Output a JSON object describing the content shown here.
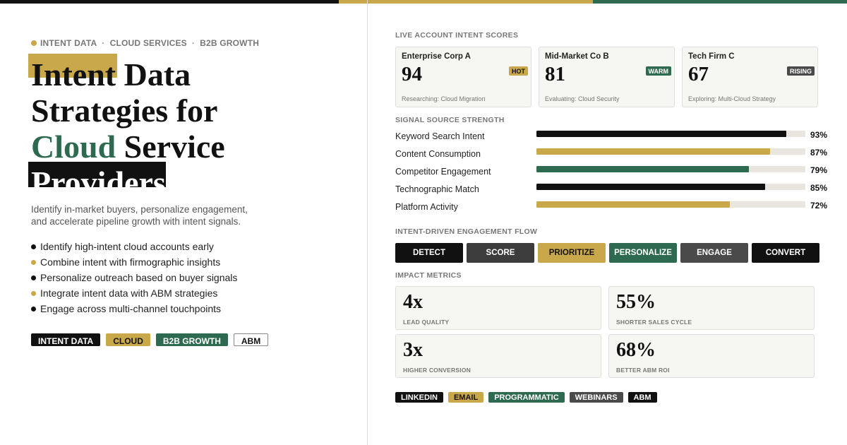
{
  "breadcrumb": [
    "INTENT DATA",
    "CLOUD SERVICES",
    "B2B GROWTH"
  ],
  "title": {
    "line1_highlight": "Intent",
    "line1_rest": " Data",
    "line2": "Strategies for",
    "line3_green": "Cloud",
    "line3_rest": " Service",
    "line4_inverted": "Providers"
  },
  "subtitle": "Identify in-market buyers, personalize engagement, and accelerate pipeline growth with intent signals.",
  "bullets": [
    {
      "text": "Identify high-intent cloud accounts early",
      "color": "#111111"
    },
    {
      "text": "Combine intent with firmographic insights",
      "color": "#c9a84c"
    },
    {
      "text": "Personalize outreach based on buyer signals",
      "color": "#111111"
    },
    {
      "text": "Integrate intent data with ABM strategies",
      "color": "#c9a84c"
    },
    {
      "text": "Engage across multi-channel touchpoints",
      "color": "#111111"
    }
  ],
  "left_tags": [
    "INTENT DATA",
    "CLOUD",
    "B2B GROWTH",
    "ABM"
  ],
  "section_labels": {
    "scores": "LIVE ACCOUNT INTENT SCORES",
    "signals": "SIGNAL SOURCE STRENGTH",
    "flow": "INTENT-DRIVEN ENGAGEMENT FLOW",
    "impact": "IMPACT METRICS"
  },
  "accounts": [
    {
      "name": "Enterprise Corp A",
      "score": "94",
      "badge": "HOT",
      "note": "Researching: Cloud Migration"
    },
    {
      "name": "Mid-Market Co B",
      "score": "81",
      "badge": "WARM",
      "note": "Evaluating: Cloud Security"
    },
    {
      "name": "Tech Firm C",
      "score": "67",
      "badge": "RISING",
      "note": "Exploring: Multi-Cloud Strategy"
    }
  ],
  "signals": [
    {
      "label": "Keyword Search Intent",
      "value": 93,
      "display": "93%",
      "color": "#111111"
    },
    {
      "label": "Content Consumption",
      "value": 87,
      "display": "87%",
      "color": "#c9a84c"
    },
    {
      "label": "Competitor Engagement",
      "value": 79,
      "display": "79%",
      "color": "#2d6a4f"
    },
    {
      "label": "Technographic Match",
      "value": 85,
      "display": "85%",
      "color": "#111111"
    },
    {
      "label": "Platform Activity",
      "value": 72,
      "display": "72%",
      "color": "#c9a84c"
    }
  ],
  "flow_steps": [
    "DETECT",
    "SCORE",
    "PRIORITIZE",
    "PERSONALIZE",
    "ENGAGE",
    "CONVERT"
  ],
  "metrics": [
    {
      "value": "4x",
      "label": "LEAD QUALITY"
    },
    {
      "value": "55%",
      "label": "SHORTER SALES CYCLE"
    },
    {
      "value": "3x",
      "label": "HIGHER CONVERSION"
    },
    {
      "value": "68%",
      "label": "BETTER ABM ROI"
    }
  ],
  "channel_tags": [
    "LINKEDIN",
    "EMAIL",
    "PROGRAMMATIC",
    "WEBINARS",
    "ABM"
  ],
  "colors": {
    "gold": "#c9a84c",
    "green": "#2d6a4f",
    "black": "#111111"
  }
}
